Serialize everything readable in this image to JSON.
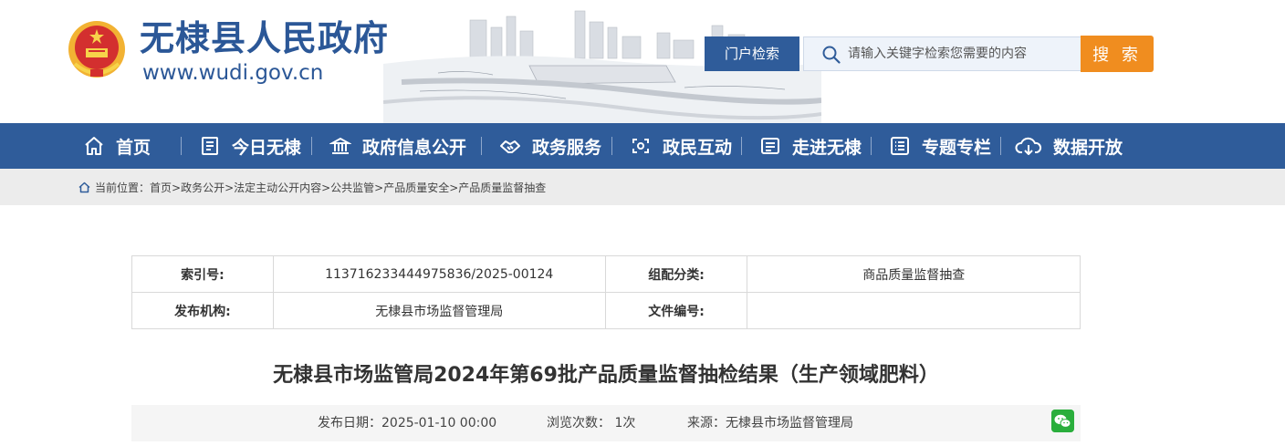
{
  "site": {
    "title": "无棣县人民政府",
    "url": "www.wudi.gov.cn"
  },
  "search": {
    "tab_label": "门户检索",
    "placeholder": "请输入关键字检索您需要的内容",
    "button_label": "搜 索"
  },
  "nav": {
    "items": [
      {
        "label": "首页",
        "icon": "home-icon"
      },
      {
        "label": "今日无棣",
        "icon": "newspaper-icon"
      },
      {
        "label": "政府信息公开",
        "icon": "government-building-icon"
      },
      {
        "label": "政务服务",
        "icon": "handshake-icon"
      },
      {
        "label": "政民互动",
        "icon": "interaction-icon"
      },
      {
        "label": "走进无棣",
        "icon": "id-card-icon"
      },
      {
        "label": "专题专栏",
        "icon": "list-icon"
      },
      {
        "label": "数据开放",
        "icon": "cloud-download-icon"
      }
    ]
  },
  "breadcrumb": {
    "prefix": "当前位置：",
    "path": "首页>政务公开>法定主动公开内容>公共监管>产品质量安全>产品质量监督抽查"
  },
  "meta": {
    "index_label": "索引号:",
    "index_value": "113716233444975836/2025-00124",
    "category_label": "组配分类:",
    "category_value": "商品质量监督抽查",
    "publisher_label": "发布机构:",
    "publisher_value": "无棣县市场监督管理局",
    "doc_no_label": "文件编号:",
    "doc_no_value": ""
  },
  "article": {
    "title": "无棣县市场监管局2024年第69批产品质量监督抽检结果（生产领域肥料）",
    "publish_date": "发布日期：2025-01-10 00:00",
    "views": "浏览次数： 1次",
    "source": "来源：无棣县市场监督管理局",
    "share_icon": "wechat-icon"
  },
  "colors": {
    "primary_blue": "#2f5c9a",
    "search_orange": "#f08d1f",
    "title_blue": "#2b5797",
    "wechat_green": "#2aae3c"
  }
}
